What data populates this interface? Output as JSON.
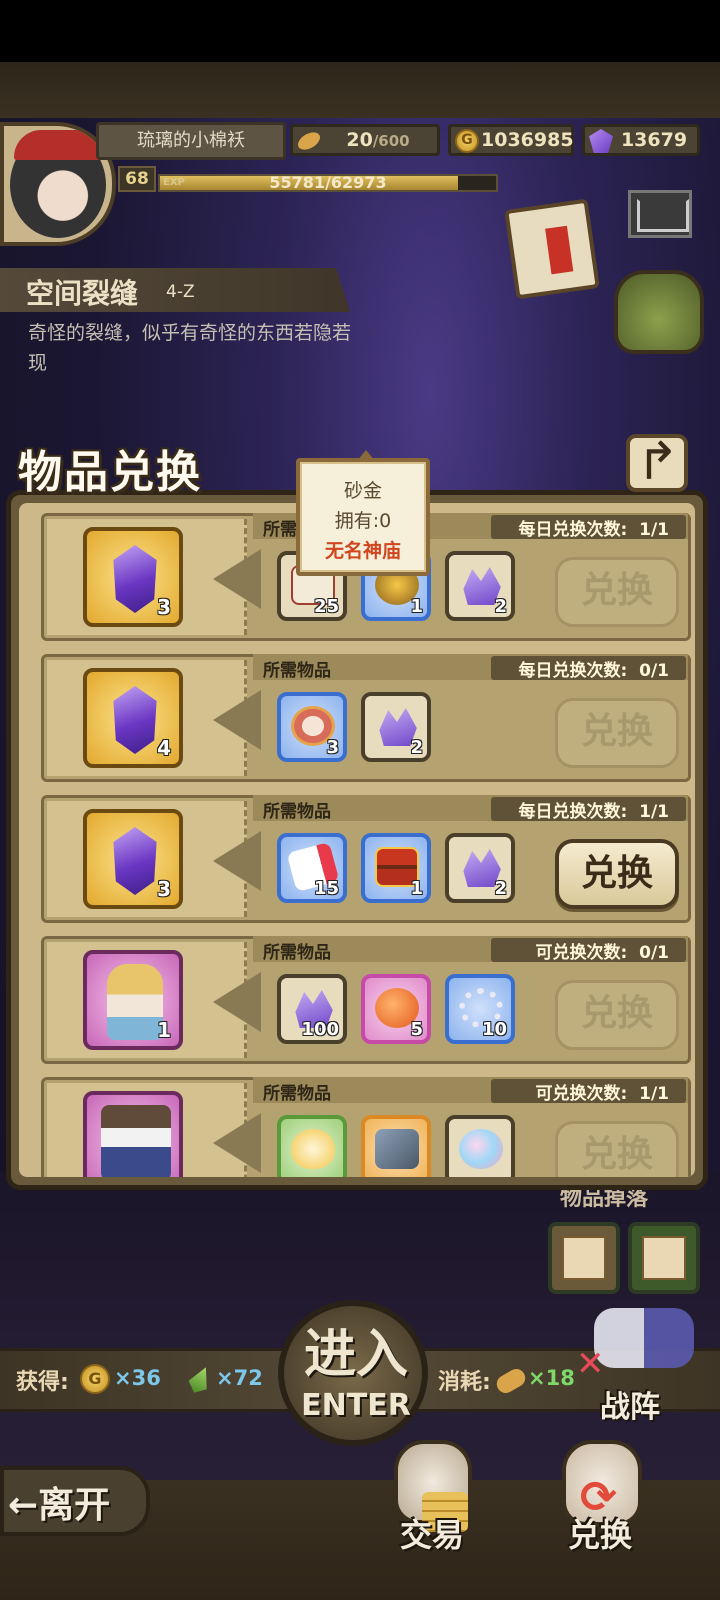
{
  "player": {
    "name": "琉璃的小棉袄",
    "level": "68",
    "exp_tag": "EXP",
    "exp_text": "55781/62973",
    "exp_fraction": 0.886
  },
  "resources": {
    "stamina": "20",
    "stamina_max": "/600",
    "gold": "1036985",
    "gems": "13679",
    "gold_icon_letter": "G"
  },
  "stage": {
    "title": "空间裂缝",
    "code": "4-Z",
    "description": "奇怪的裂缝，似乎有奇怪的东西若隐若现"
  },
  "panel": {
    "title": "物品兑换",
    "required_label": "所需物品",
    "exchange_label": "兑换"
  },
  "tooltip": {
    "item_name": "砂金",
    "owned": "拥有:0",
    "source": "无名神庙"
  },
  "rows": [
    {
      "reward_qty": "3",
      "count_label": "每日兑换次数:",
      "count_value": "1/1",
      "items": [
        {
          "icon": "scroll-icon",
          "qty": "25"
        },
        {
          "icon": "gold-sand-icon",
          "qty": "1"
        },
        {
          "icon": "crystal-shard-icon",
          "qty": "2"
        }
      ],
      "active": false
    },
    {
      "reward_qty": "4",
      "count_label": "每日兑换次数:",
      "count_value": "0/1",
      "items": [
        {
          "icon": "coin-token-icon",
          "qty": "3"
        },
        {
          "icon": "crystal-shard-icon",
          "qty": "2"
        }
      ],
      "active": false
    },
    {
      "reward_qty": "3",
      "count_label": "每日兑换次数:",
      "count_value": "1/1",
      "items": [
        {
          "icon": "ticket-icon",
          "qty": "15"
        },
        {
          "icon": "treasure-chest-icon",
          "qty": "1"
        },
        {
          "icon": "crystal-shard-icon",
          "qty": "2"
        }
      ],
      "active": true
    },
    {
      "reward_qty": "1",
      "count_label": "可兑换次数:",
      "count_value": "0/1",
      "items": [
        {
          "icon": "crystal-shard-icon",
          "qty": "100"
        },
        {
          "icon": "star-ball-icon",
          "qty": "5"
        },
        {
          "icon": "pearl-ring-icon",
          "qty": "10"
        }
      ],
      "active": false
    },
    {
      "reward_qty": "",
      "count_label": "可兑换次数:",
      "count_value": "1/1",
      "items": [
        {
          "icon": "egg-icon",
          "qty": ""
        },
        {
          "icon": "ore-icon",
          "qty": ""
        },
        {
          "icon": "rainbow-orb-icon",
          "qty": ""
        }
      ],
      "active": false
    }
  ],
  "bottom": {
    "map_label": "物品掉落",
    "gain_label": "获得:",
    "gain_gold": "×36",
    "gain_feather": "×72",
    "cost_label": "消耗:",
    "cost_bread": "×18",
    "enter_cn": "进入",
    "enter_en": "ENTER",
    "formation": "战阵",
    "leave": "←离开",
    "trade": "交易",
    "exchange": "兑换"
  }
}
